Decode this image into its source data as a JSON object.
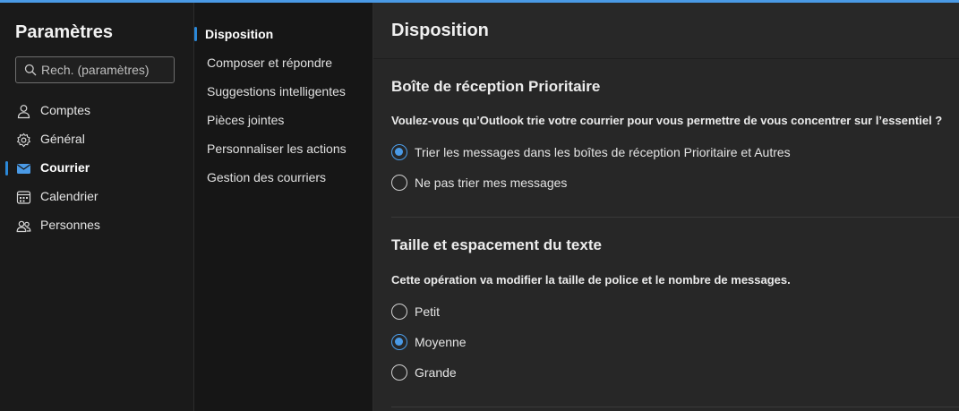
{
  "settings": {
    "title": "Paramètres",
    "search_placeholder": "Rech. (paramètres)",
    "categories": [
      {
        "label": "Comptes",
        "icon": "person-icon"
      },
      {
        "label": "Général",
        "icon": "gear-icon"
      },
      {
        "label": "Courrier",
        "icon": "mail-icon",
        "selected": true
      },
      {
        "label": "Calendrier",
        "icon": "calendar-icon"
      },
      {
        "label": "Personnes",
        "icon": "people-icon"
      }
    ]
  },
  "submenu": {
    "items": [
      {
        "label": "Disposition",
        "selected": true
      },
      {
        "label": "Composer et répondre"
      },
      {
        "label": "Suggestions intelligentes"
      },
      {
        "label": "Pièces jointes"
      },
      {
        "label": "Personnaliser les actions"
      },
      {
        "label": "Gestion des courriers"
      }
    ]
  },
  "content": {
    "title": "Disposition",
    "focused_inbox": {
      "title": "Boîte de réception Prioritaire",
      "question": "Voulez-vous qu’Outlook trie votre courrier pour vous permettre de vous concentrer sur l’essentiel ?",
      "options": [
        {
          "label": "Trier les messages dans les boîtes de réception Prioritaire et Autres",
          "checked": true
        },
        {
          "label": "Ne pas trier mes messages",
          "checked": false
        }
      ]
    },
    "text_size": {
      "title": "Taille et espacement du texte",
      "description": "Cette opération va modifier la taille de police et le nombre de messages.",
      "options": [
        {
          "label": "Petit",
          "checked": false
        },
        {
          "label": "Moyenne",
          "checked": true
        },
        {
          "label": "Grande",
          "checked": false
        }
      ]
    }
  },
  "colors": {
    "accent": "#4a9ae6",
    "selection_bar": "#2b88d8"
  }
}
